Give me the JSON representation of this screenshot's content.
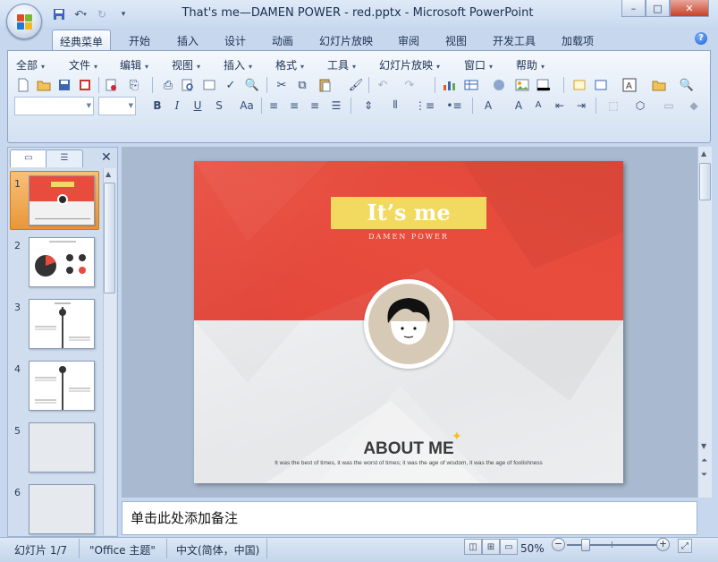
{
  "window": {
    "title": "That's me—DAMEN POWER - red.pptx - Microsoft PowerPoint",
    "controls": {
      "minimize": "–",
      "maximize": "□",
      "close": "✕"
    }
  },
  "ribbon_tabs": [
    "经典菜单",
    "开始",
    "插入",
    "设计",
    "动画",
    "幻灯片放映",
    "审阅",
    "视图",
    "开发工具",
    "加载项"
  ],
  "active_tab": "经典菜单",
  "menu": [
    "全部",
    "文件",
    "编辑",
    "视图",
    "插入",
    "格式",
    "工具",
    "幻灯片放映",
    "窗口",
    "帮助"
  ],
  "format_buttons": {
    "bold": "B",
    "italic": "I",
    "underline": "U",
    "shadow": "S",
    "change_case": "Aa",
    "font_color": "A"
  },
  "slide_pane": {
    "numbers": [
      "1",
      "2",
      "3",
      "4",
      "5",
      "6"
    ]
  },
  "slide": {
    "title": "It’s me",
    "subtitle": "DAMEN POWER",
    "section_title": "ABOUT ME",
    "body": "It was the best of times, it was the worst of times; it was the age of wisdom, it was the age of foolishness"
  },
  "notes": {
    "placeholder": "单击此处添加备注"
  },
  "status": {
    "slide": "幻灯片 1/7",
    "theme": "\"Office 主题\"",
    "language": "中文(简体，中国)",
    "zoom": "50%",
    "zoom_value": 50
  },
  "colors": {
    "slide_red": "#e84c3d",
    "title_box_yellow": "#f1da5f",
    "selection_orange": "#e9963a"
  }
}
